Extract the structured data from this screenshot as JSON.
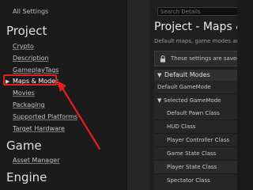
{
  "nav": {
    "all_settings": "All Settings",
    "sections": [
      {
        "title": "Project",
        "items": [
          "Crypto",
          "Description",
          "GameplayTags",
          "Maps & Modes",
          "Movies",
          "Packaging",
          "Supported Platforms",
          "Target Hardware"
        ]
      },
      {
        "title": "Game",
        "items": [
          "Asset Manager"
        ]
      },
      {
        "title": "Engine",
        "items": []
      }
    ],
    "selected_item": "Maps & Modes"
  },
  "details": {
    "search_placeholder": "Search Details",
    "page_title": "Project - Maps & Modes",
    "page_description": "Default maps, game modes and other map related settings.",
    "notice": "These settings are saved in DefaultEngine.ini",
    "category": "Default Modes",
    "rows": [
      "Default GameMode",
      "Selected GameMode",
      "Default Pawn Class",
      "HUD Class",
      "Player Controller Class",
      "Game State Class",
      "Player State Class",
      "Spectator Class"
    ]
  },
  "colors": {
    "annotation": "#e51e1e",
    "background": "#1a1a1a",
    "panel": "#262626"
  }
}
